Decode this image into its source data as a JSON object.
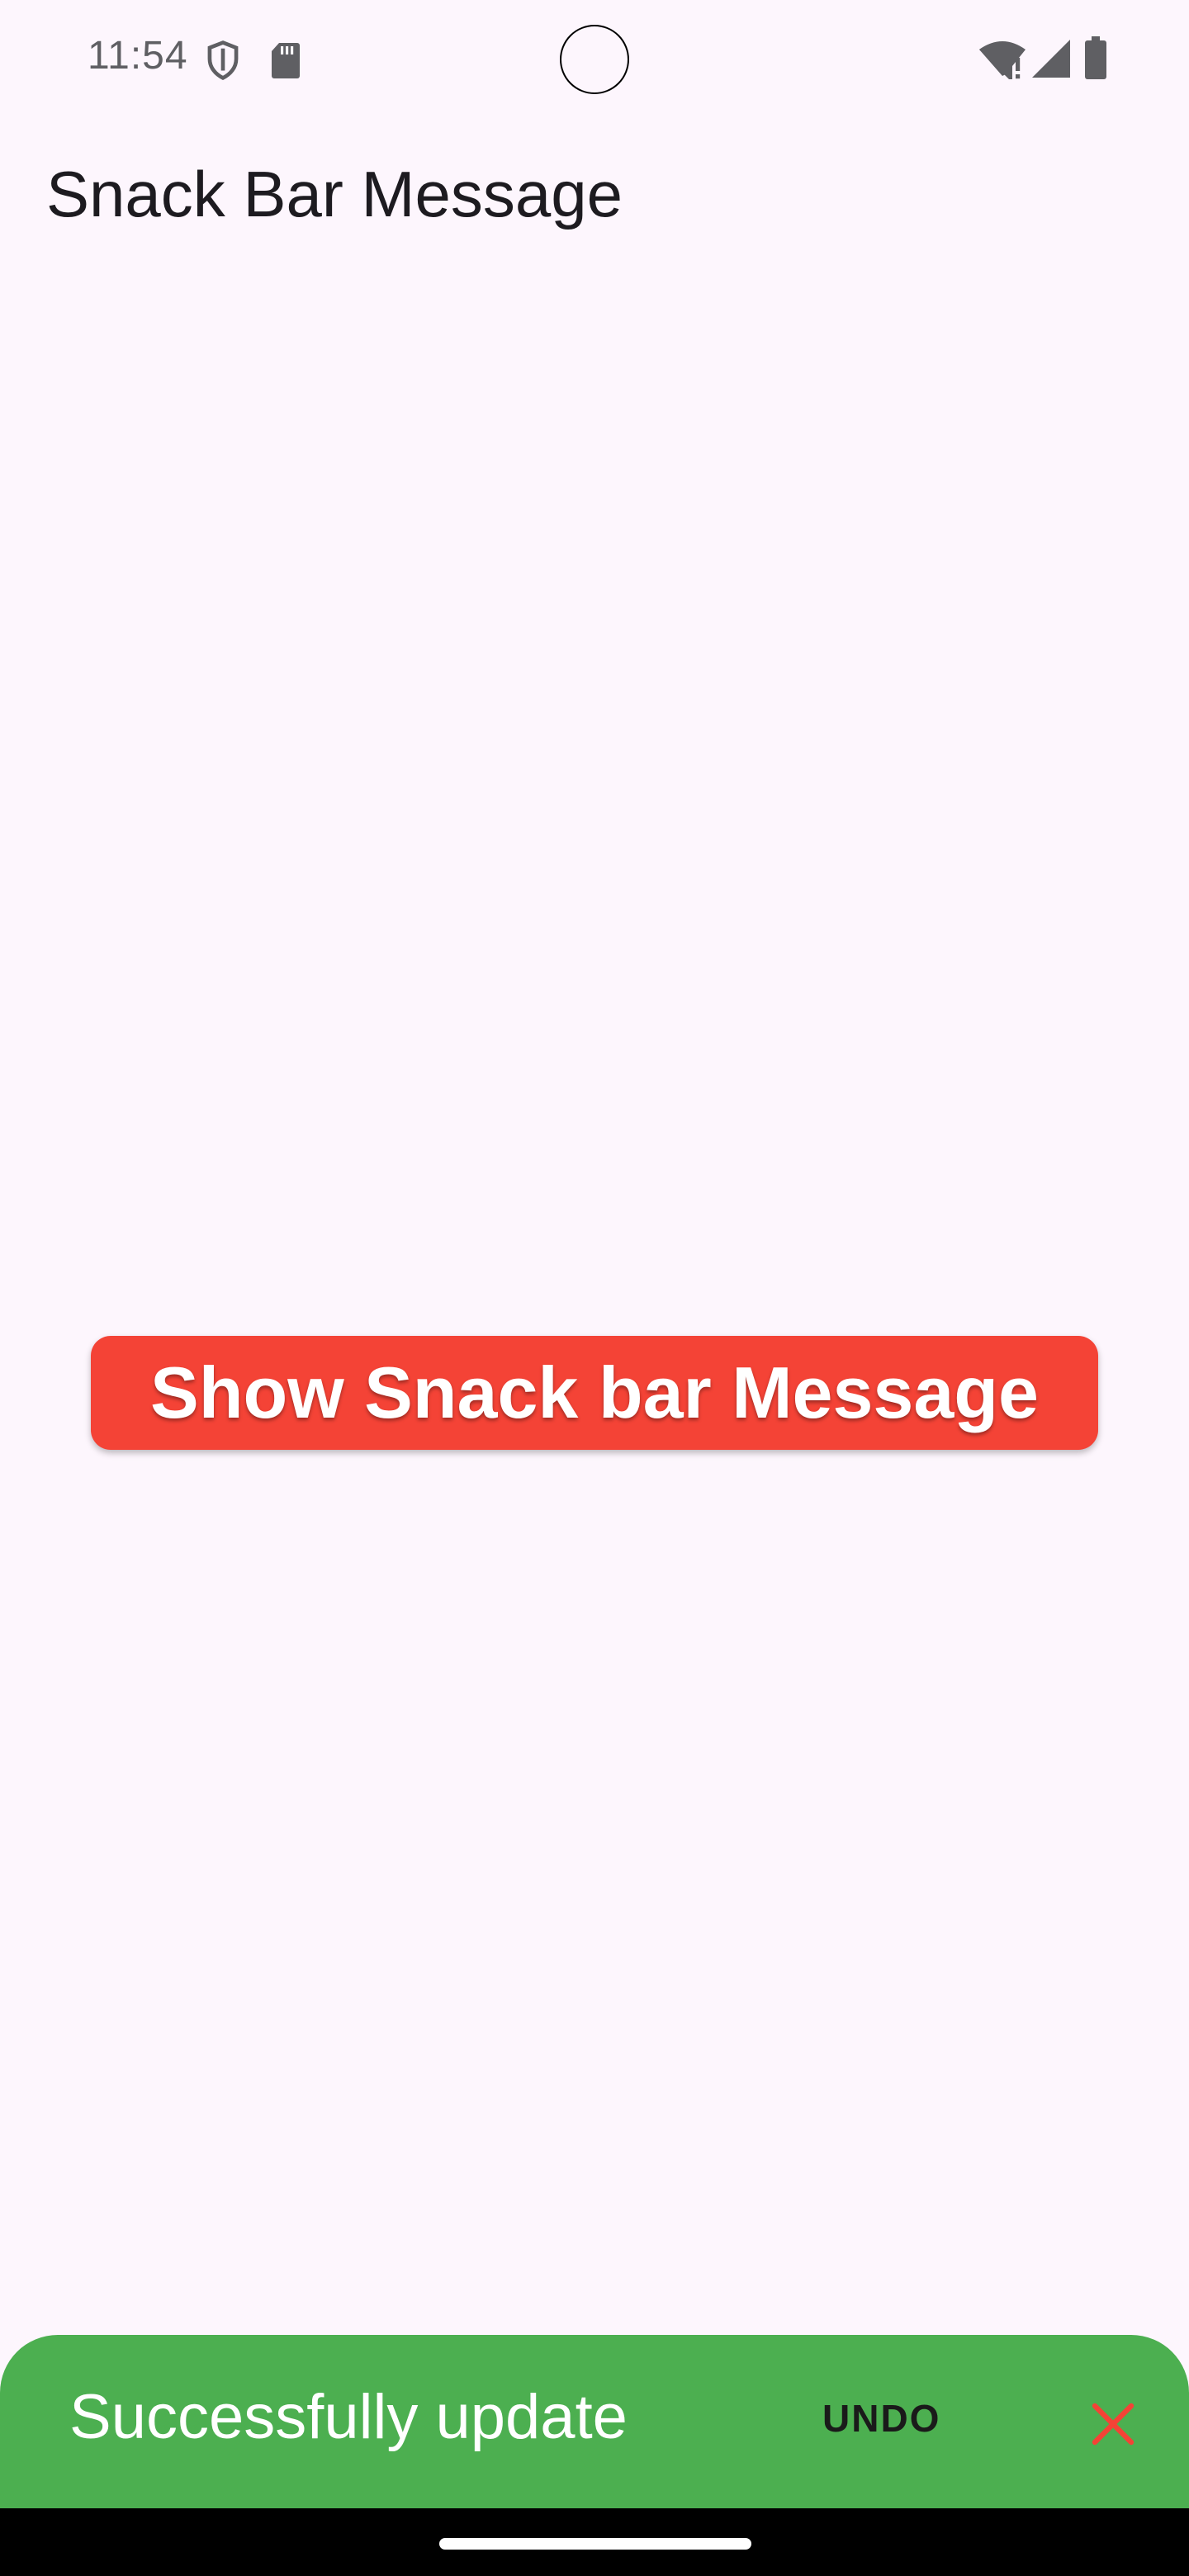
{
  "status_bar": {
    "time": "11:54",
    "icons": [
      "shield-icon",
      "sd-card-icon",
      "wifi-alert-icon",
      "cell-signal-icon",
      "battery-icon"
    ]
  },
  "app_bar": {
    "title": "Snack Bar Message"
  },
  "main": {
    "button_label": "Show Snack bar Message",
    "button_color": "#f44336"
  },
  "snackbar": {
    "message": "Successfully update",
    "action_label": "UNDO",
    "close_icon": "close-icon",
    "background_color": "#4caf50",
    "close_color": "#f44336"
  },
  "colors": {
    "background": "#fdf6fd"
  }
}
